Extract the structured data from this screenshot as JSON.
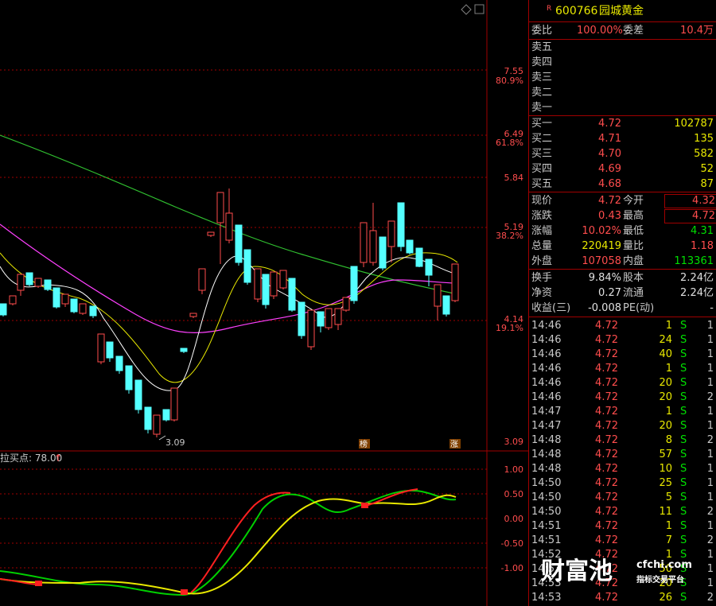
{
  "header": {
    "marker": "R",
    "code": "600766",
    "name": "园城黄金"
  },
  "ratio": {
    "wb_label": "委比",
    "wb_value": "100.00%",
    "wc_label": "委差",
    "wc_value": "10.4万"
  },
  "sell": [
    {
      "label": "卖五"
    },
    {
      "label": "卖四"
    },
    {
      "label": "卖三"
    },
    {
      "label": "卖二"
    },
    {
      "label": "卖一"
    }
  ],
  "buy": [
    {
      "label": "买一",
      "price": "4.72",
      "vol": "102787"
    },
    {
      "label": "买二",
      "price": "4.71",
      "vol": "135"
    },
    {
      "label": "买三",
      "price": "4.70",
      "vol": "582"
    },
    {
      "label": "买四",
      "price": "4.69",
      "vol": "52"
    },
    {
      "label": "买五",
      "price": "4.68",
      "vol": "87"
    }
  ],
  "quote": [
    {
      "l1": "现价",
      "v1": "4.72",
      "l2": "今开",
      "v2": "4.32"
    },
    {
      "l1": "涨跌",
      "v1": "0.43",
      "l2": "最高",
      "v2": "4.72"
    },
    {
      "l1": "涨幅",
      "v1": "10.02%",
      "l2": "最低",
      "v2": "4.31"
    },
    {
      "l1": "总量",
      "v1": "220419",
      "l2": "量比",
      "v2": "1.18"
    },
    {
      "l1": "外盘",
      "v1": "107058",
      "l2": "内盘",
      "v2": "113361"
    }
  ],
  "stats": [
    {
      "l1": "换手",
      "v1": "9.84%",
      "l2": "股本",
      "v2": "2.24亿"
    },
    {
      "l1": "净资",
      "v1": "0.27",
      "l2": "流通",
      "v2": "2.24亿"
    },
    {
      "l1": "收益(三)",
      "v1": "-0.008",
      "l2": "PE(动)",
      "v2": "-"
    }
  ],
  "trades": [
    {
      "t": "14:46",
      "p": "4.72",
      "v": "1",
      "s": "S",
      "n": "1"
    },
    {
      "t": "14:46",
      "p": "4.72",
      "v": "24",
      "s": "S",
      "n": "1"
    },
    {
      "t": "14:46",
      "p": "4.72",
      "v": "40",
      "s": "S",
      "n": "1"
    },
    {
      "t": "14:46",
      "p": "4.72",
      "v": "1",
      "s": "S",
      "n": "1"
    },
    {
      "t": "14:46",
      "p": "4.72",
      "v": "20",
      "s": "S",
      "n": "1"
    },
    {
      "t": "14:46",
      "p": "4.72",
      "v": "20",
      "s": "S",
      "n": "2"
    },
    {
      "t": "14:47",
      "p": "4.72",
      "v": "1",
      "s": "S",
      "n": "1"
    },
    {
      "t": "14:47",
      "p": "4.72",
      "v": "20",
      "s": "S",
      "n": "1"
    },
    {
      "t": "14:48",
      "p": "4.72",
      "v": "8",
      "s": "S",
      "n": "2"
    },
    {
      "t": "14:48",
      "p": "4.72",
      "v": "57",
      "s": "S",
      "n": "1"
    },
    {
      "t": "14:48",
      "p": "4.72",
      "v": "10",
      "s": "S",
      "n": "1"
    },
    {
      "t": "14:50",
      "p": "4.72",
      "v": "25",
      "s": "S",
      "n": "1"
    },
    {
      "t": "14:50",
      "p": "4.72",
      "v": "5",
      "s": "S",
      "n": "1"
    },
    {
      "t": "14:50",
      "p": "4.72",
      "v": "11",
      "s": "S",
      "n": "2"
    },
    {
      "t": "14:51",
      "p": "4.72",
      "v": "1",
      "s": "S",
      "n": "1"
    },
    {
      "t": "14:51",
      "p": "4.72",
      "v": "7",
      "s": "S",
      "n": "2"
    },
    {
      "t": "14:52",
      "p": "4.72",
      "v": "1",
      "s": "S",
      "n": "1"
    },
    {
      "t": "14:53",
      "p": "4.72",
      "v": "50",
      "s": "S",
      "n": "1"
    },
    {
      "t": "14:53",
      "p": "4.72",
      "v": "20",
      "s": "S",
      "n": "1"
    },
    {
      "t": "14:53",
      "p": "4.72",
      "v": "26",
      "s": "S",
      "n": "2"
    }
  ],
  "price_axis": [
    {
      "price": "7.55",
      "pct": "80.9%"
    },
    {
      "price": "6.49",
      "pct": "61.8%"
    },
    {
      "price": "5.84",
      "pct": ""
    },
    {
      "price": "5.19",
      "pct": "38.2%"
    },
    {
      "price": "4.14",
      "pct": "19.1%"
    },
    {
      "price": "3.09",
      "pct": ""
    }
  ],
  "osc_axis": [
    "1.00",
    "0.50",
    "0.00",
    "-0.50",
    "-1.00"
  ],
  "low_marker": "3.09",
  "flag_bang": "榜",
  "flag_zhang": "涨",
  "indicator_label": "拉买点: 78.00",
  "indicator_arrow": "↑",
  "watermark": {
    "brand": "财富池",
    "site": "cfchi.com",
    "slogan": "指标交易平台"
  },
  "colors": {
    "up": "#ff4d4d",
    "down": "#54ffff",
    "ma_white": "#ffffff",
    "ma_yellow": "#e8e800",
    "ma_magenta": "#ff40ff",
    "ma_green": "#30c030",
    "grid": "#a00000"
  }
}
